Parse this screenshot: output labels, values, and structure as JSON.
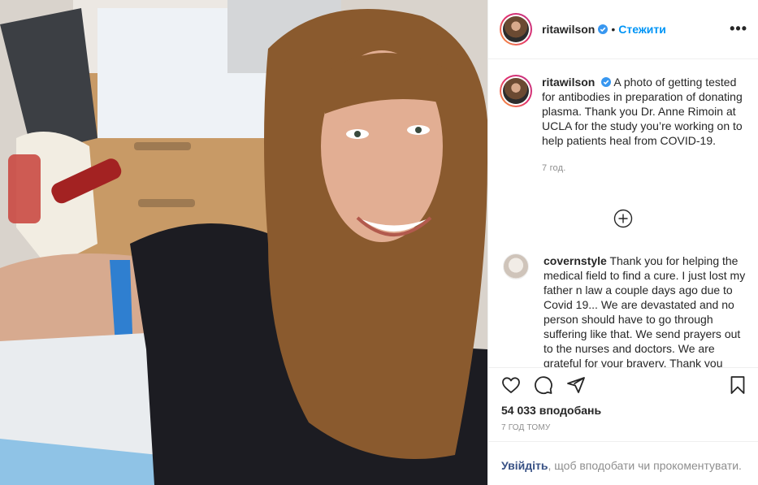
{
  "post": {
    "username": "ritawilson",
    "follow_label": "Стежити",
    "separator": "•",
    "more_label": "•••",
    "caption": "A photo of getting tested for antibodies in preparation of donating plasma. Thank you Dr. Anne Rimoin at UCLA for the study you’re working on to help patients heal from COVID-19.",
    "caption_time": "7 год."
  },
  "comment": {
    "username": "covernstyle",
    "text": "Thank you for helping the medical field to find a cure. I just lost my father n law a couple days ago due to Covid 19... We are devastated and no person should have to go through suffering like that. We send prayers out to the nurses and doctors. We are grateful for your bravery. Thank you"
  },
  "engagement": {
    "likes": "54 033 вподобань",
    "posted": "7 ГОД ТОМУ"
  },
  "login_prompt": {
    "link": "Увійдіть",
    "rest": ", щоб вподобати чи прокоментувати."
  },
  "colors": {
    "accent": "#0095f6",
    "verified": "#3897f0",
    "muted": "#8e8e8e",
    "link": "#385185"
  },
  "icons": [
    "verified-badge-icon",
    "more-options-icon",
    "load-more-icon",
    "heart-icon",
    "comment-icon",
    "share-icon",
    "bookmark-icon"
  ]
}
